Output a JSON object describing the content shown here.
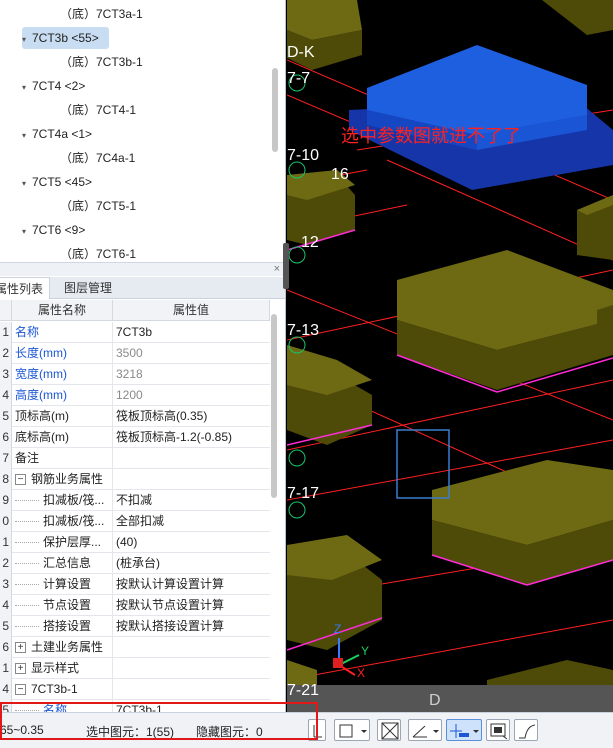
{
  "tree": {
    "items": [
      {
        "label": "（底）7CT3a-1",
        "level": "child"
      },
      {
        "label": "7CT3b <55>",
        "level": "parent",
        "selected": true
      },
      {
        "label": "（底）7CT3b-1",
        "level": "child"
      },
      {
        "label": "7CT4 <2>",
        "level": "parent"
      },
      {
        "label": "（底）7CT4-1",
        "level": "child"
      },
      {
        "label": "7CT4a <1>",
        "level": "parent"
      },
      {
        "label": "（底）7C4a-1",
        "level": "child"
      },
      {
        "label": "7CT5 <45>",
        "level": "parent"
      },
      {
        "label": "（底）7CT5-1",
        "level": "child"
      },
      {
        "label": "7CT6 <9>",
        "level": "parent"
      },
      {
        "label": "（底）7CT6-1",
        "level": "child"
      }
    ]
  },
  "panel": {
    "close": "×",
    "tabs": [
      "属性列表",
      "图层管理"
    ]
  },
  "grid": {
    "headers": [
      "属性名称",
      "属性值"
    ],
    "rows": [
      {
        "num": "1",
        "name": "名称",
        "value": "7CT3b",
        "name_color": "blue"
      },
      {
        "num": "2",
        "name": "长度(mm)",
        "value": "3500",
        "name_color": "blue",
        "value_color": "gray"
      },
      {
        "num": "3",
        "name": "宽度(mm)",
        "value": "3218",
        "name_color": "blue",
        "value_color": "gray"
      },
      {
        "num": "4",
        "name": "高度(mm)",
        "value": "1200",
        "name_color": "blue",
        "value_color": "gray"
      },
      {
        "num": "5",
        "name": "顶标高(m)",
        "value": "筏板顶标高(0.35)"
      },
      {
        "num": "6",
        "name": "底标高(m)",
        "value": "筏板顶标高-1.2(-0.85)"
      },
      {
        "num": "7",
        "name": "备注",
        "value": ""
      },
      {
        "num": "8",
        "name": "钢筋业务属性",
        "value": "",
        "expander": "−"
      },
      {
        "num": "9",
        "name": "扣减板/筏...",
        "value": "不扣减",
        "indent": true
      },
      {
        "num": "0",
        "name": "扣减板/筏...",
        "value": "全部扣减",
        "indent": true
      },
      {
        "num": "1",
        "name": "保护层厚...",
        "value": "(40)",
        "indent": true
      },
      {
        "num": "2",
        "name": "汇总信息",
        "value": "(桩承台)",
        "indent": true
      },
      {
        "num": "3",
        "name": "计算设置",
        "value": "按默认计算设置计算",
        "indent": true
      },
      {
        "num": "4",
        "name": "节点设置",
        "value": "按默认节点设置计算",
        "indent": true
      },
      {
        "num": "5",
        "name": "搭接设置",
        "value": "按默认搭接设置计算",
        "indent": true
      },
      {
        "num": "6",
        "name": "土建业务属性",
        "value": "",
        "expander": "+"
      },
      {
        "num": "1",
        "name": "显示样式",
        "value": "",
        "expander": "+"
      },
      {
        "num": "4",
        "name": "7CT3b-1",
        "value": "",
        "expander": "−"
      },
      {
        "num": "5",
        "name": "名称",
        "value": "7CT3b-1",
        "name_color": "blue",
        "indent": true
      }
    ]
  },
  "viewport": {
    "labels": [
      "D-K",
      "7-7",
      "7-10",
      "16",
      "12",
      "7-13",
      "7-17",
      "7-21",
      "D"
    ],
    "annotation": "选中参数图就进不了了",
    "annotation_color": "#ff2020",
    "axis": {
      "z": "Z",
      "y": "Y",
      "x": "X"
    }
  },
  "status": {
    "elevation": "65~0.35",
    "selected": "选中图元：1(55)",
    "hidden": "隐藏图元：0"
  },
  "colors": {
    "selected_block": "#1e5fe0",
    "block_top": "#6e6a13",
    "block_side": "#4e4b08",
    "axis_red": "#ff2020",
    "outline_magenta": "#ff2bd6"
  }
}
